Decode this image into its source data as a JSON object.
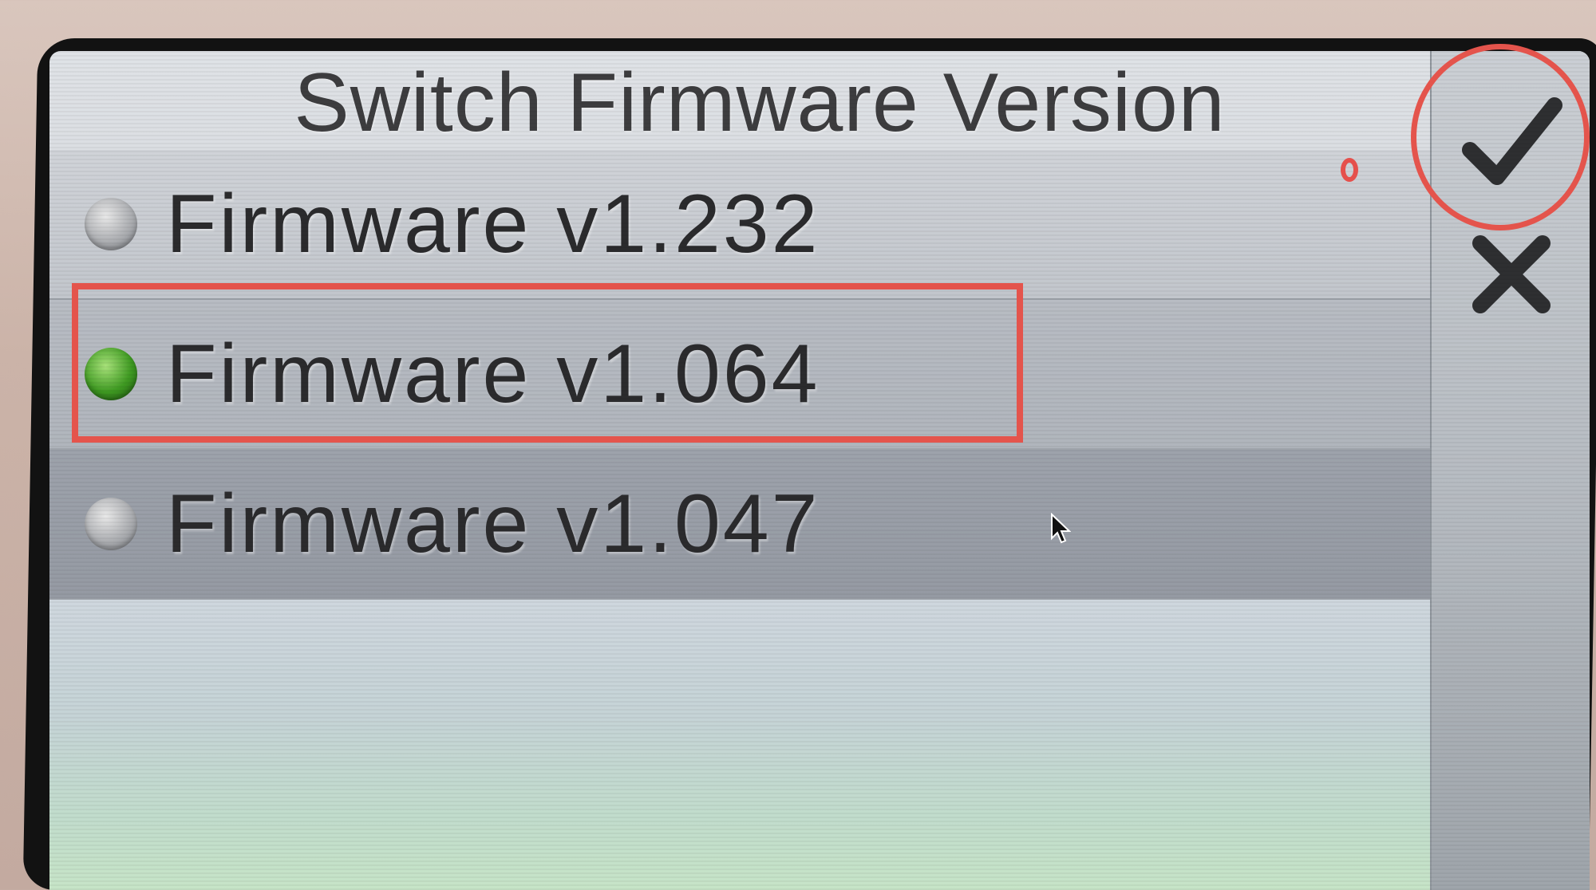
{
  "dialog": {
    "title": "Switch Firmware Version",
    "options": [
      {
        "label": "Firmware v1.232",
        "selected": false
      },
      {
        "label": "Firmware v1.064",
        "selected": true
      },
      {
        "label": "Firmware v1.047",
        "selected": false
      }
    ],
    "buttons": {
      "confirm_icon": "checkmark-icon",
      "cancel_icon": "close-icon"
    }
  },
  "colors": {
    "annotation": "#e4544c",
    "selected_radio": "#3f9a22"
  }
}
